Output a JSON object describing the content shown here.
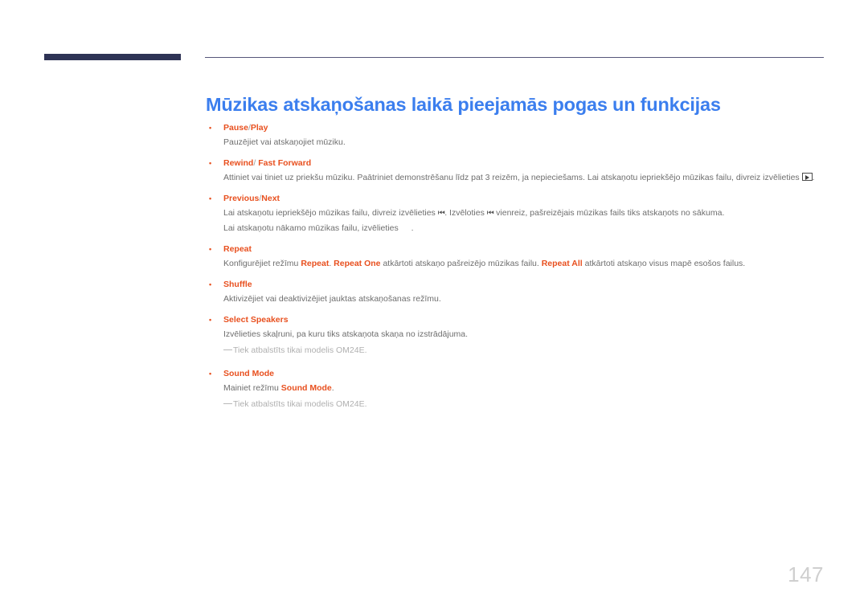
{
  "document": {
    "title": "Mūzikas atskaņošanas laikā pieejamās pogas un funkcijas",
    "page_number": "147",
    "colors": {
      "title_blue": "#3b7eee",
      "accent_orange": "#e8501f",
      "header_bar_navy": "#2e3355",
      "body_gray": "#6e6e6e",
      "note_gray": "#b0b0b0",
      "page_number_gray": "#cfcfcf"
    }
  },
  "sections": {
    "pause_play": {
      "bullet": "•",
      "term_a": "Pause",
      "separator": "/",
      "term_b": "Play",
      "description": "Pauzējiet vai atskaņojiet mūziku."
    },
    "rewind_fast_forward": {
      "bullet": "•",
      "term_a": "Rewind",
      "separator": "/",
      "term_b": "Fast Forward",
      "description_part1": "Attiniet vai tiniet uz priekšu mūziku. Paātriniet demonstrēšanu līdz pat 3 reizēm, ja nepieciešams. Lai atskaņotu iepriekšējo mūzikas failu, divreiz izvēlieties",
      "icon": "play-button-boxed-icon",
      "description_part2": "."
    },
    "previous_next": {
      "bullet": "•",
      "term_a": "Previous",
      "separator": "/",
      "term_b": "Next",
      "line1_part1": "Lai atskaņotu iepriekšējo mūzikas failu, divreiz izvēlieties",
      "line1_icon1": "⏮",
      "line1_part2": ". Izvēloties",
      "line1_icon2": "⏮",
      "line1_part3": "vienreiz, pašreizējais mūzikas fails tiks atskaņots no sākuma.",
      "line2_part1": "Lai atskaņotu nākamo mūzikas failu, izvēlieties",
      "line2_icon": "next-track-missing-glyph-icon",
      "line2_part2": "."
    },
    "repeat": {
      "bullet": "•",
      "term": "Repeat",
      "desc_part1": "Konfigurējiet režīmu",
      "hl1": "Repeat",
      "desc_part2": ".",
      "hl2": "Repeat One",
      "desc_part3": "atkārtoti atskaņo pašreizējo mūzikas failu.",
      "hl3": "Repeat All",
      "desc_part4": "atkārtoti atskaņo visus mapē esošos failus."
    },
    "shuffle": {
      "bullet": "•",
      "term": "Shuffle",
      "description": "Aktivizējiet vai deaktivizējiet jauktas atskaņošanas režīmu."
    },
    "select_speakers": {
      "bullet": "•",
      "term": "Select Speakers",
      "description": "Izvēlieties skaļruni, pa kuru tiks atskaņota skaņa no izstrādājuma.",
      "note": "Tiek atbalstīts tikai modelis OM24E."
    },
    "sound_mode": {
      "bullet": "•",
      "term": "Sound Mode",
      "desc_part1": "Mainiet režīmu",
      "hl1": "Sound Mode",
      "desc_part2": ".",
      "note": "Tiek atbalstīts tikai modelis OM24E."
    }
  }
}
